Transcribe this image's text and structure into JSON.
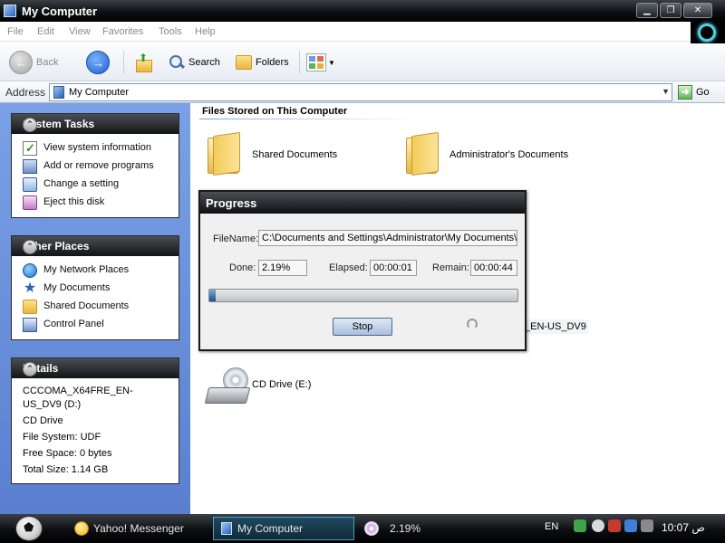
{
  "window": {
    "title": "My Computer",
    "controls": [
      "minimize",
      "maximize",
      "close"
    ]
  },
  "menu": [
    "File",
    "Edit",
    "View",
    "Favorites",
    "Tools",
    "Help"
  ],
  "toolbar": {
    "back_label": "Back",
    "search_label": "Search",
    "folders_label": "Folders"
  },
  "address": {
    "label": "Address",
    "value": "My Computer",
    "go_label": "Go"
  },
  "system_tasks": {
    "title": "System Tasks",
    "items": [
      {
        "label": "View system information",
        "icon": "check-icon"
      },
      {
        "label": "Add or remove programs",
        "icon": "programs-icon"
      },
      {
        "label": "Change a setting",
        "icon": "control-panel-icon"
      },
      {
        "label": "Eject this disk",
        "icon": "eject-icon"
      }
    ]
  },
  "other_places": {
    "title": "Other Places",
    "items": [
      {
        "label": "My Network Places",
        "icon": "globe-icon"
      },
      {
        "label": "My Documents",
        "icon": "star-icon"
      },
      {
        "label": "Shared Documents",
        "icon": "folder-icon"
      },
      {
        "label": "Control Panel",
        "icon": "control-panel-icon"
      }
    ]
  },
  "details": {
    "title": "Details",
    "name": "CCCOMA_X64FRE_EN-US_DV9 (D:)",
    "type": "CD Drive",
    "file_system": "File System: UDF",
    "free_space": "Free Space: 0 bytes",
    "total_size": "Total Size: 1.14 GB"
  },
  "content": {
    "section_title": "Files Stored on This Computer",
    "items": [
      {
        "label": "Shared Documents",
        "icon": "folder-icon"
      },
      {
        "label": "Administrator's Documents",
        "icon": "folder-icon"
      },
      {
        "label": "CD Drive (E:)",
        "icon": "cd-drive-icon"
      }
    ],
    "partial_label": "_EN-US_DV9"
  },
  "progress_dialog": {
    "title": "Progress",
    "filename_label": "FileName:",
    "filename_value": "C:\\Documents and Settings\\Administrator\\My Documents\\s",
    "done_label": "Done:",
    "done_value": "2.19%",
    "elapsed_label": "Elapsed:",
    "elapsed_value": "00:00:01",
    "remain_label": "Remain:",
    "remain_value": "00:00:44",
    "progress_fraction": 0.0219,
    "stop_label": "Stop"
  },
  "taskbar": {
    "apps": [
      {
        "label": "Yahoo! Messenger",
        "icon": "yahoo-icon",
        "active": false
      },
      {
        "label": "My Computer",
        "icon": "my-computer-icon",
        "active": true
      }
    ],
    "progress_text": "2.19%",
    "language": "EN",
    "clock": "10:07 ص"
  },
  "colors": {
    "title_bar": "#0d1013",
    "task_pane": "#6a8fdc",
    "accent": "#1f4f8f"
  }
}
